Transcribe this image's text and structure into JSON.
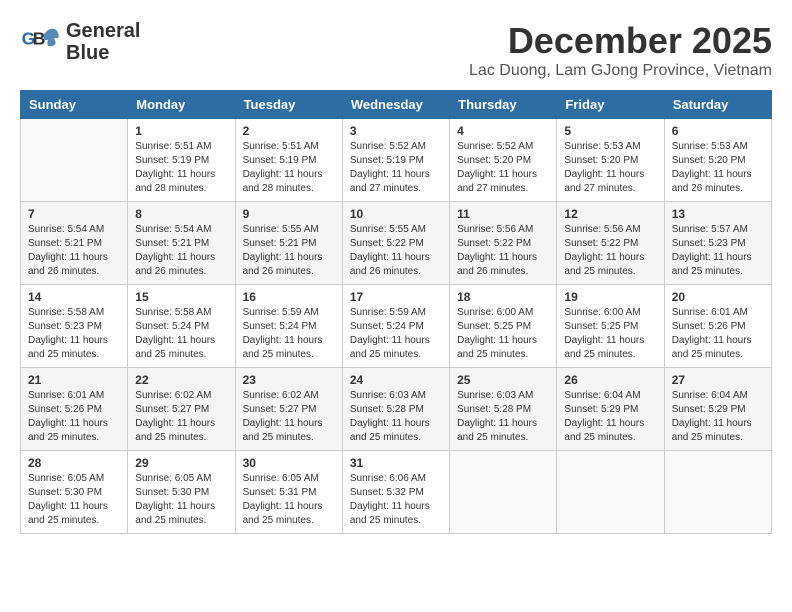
{
  "logo": {
    "line1": "General",
    "line2": "Blue"
  },
  "title": "December 2025",
  "subtitle": "Lac Duong, Lam GJong Province, Vietnam",
  "days_of_week": [
    "Sunday",
    "Monday",
    "Tuesday",
    "Wednesday",
    "Thursday",
    "Friday",
    "Saturday"
  ],
  "weeks": [
    [
      {
        "day": "",
        "info": ""
      },
      {
        "day": "1",
        "info": "Sunrise: 5:51 AM\nSunset: 5:19 PM\nDaylight: 11 hours\nand 28 minutes."
      },
      {
        "day": "2",
        "info": "Sunrise: 5:51 AM\nSunset: 5:19 PM\nDaylight: 11 hours\nand 28 minutes."
      },
      {
        "day": "3",
        "info": "Sunrise: 5:52 AM\nSunset: 5:19 PM\nDaylight: 11 hours\nand 27 minutes."
      },
      {
        "day": "4",
        "info": "Sunrise: 5:52 AM\nSunset: 5:20 PM\nDaylight: 11 hours\nand 27 minutes."
      },
      {
        "day": "5",
        "info": "Sunrise: 5:53 AM\nSunset: 5:20 PM\nDaylight: 11 hours\nand 27 minutes."
      },
      {
        "day": "6",
        "info": "Sunrise: 5:53 AM\nSunset: 5:20 PM\nDaylight: 11 hours\nand 26 minutes."
      }
    ],
    [
      {
        "day": "7",
        "info": "Sunrise: 5:54 AM\nSunset: 5:21 PM\nDaylight: 11 hours\nand 26 minutes."
      },
      {
        "day": "8",
        "info": "Sunrise: 5:54 AM\nSunset: 5:21 PM\nDaylight: 11 hours\nand 26 minutes."
      },
      {
        "day": "9",
        "info": "Sunrise: 5:55 AM\nSunset: 5:21 PM\nDaylight: 11 hours\nand 26 minutes."
      },
      {
        "day": "10",
        "info": "Sunrise: 5:55 AM\nSunset: 5:22 PM\nDaylight: 11 hours\nand 26 minutes."
      },
      {
        "day": "11",
        "info": "Sunrise: 5:56 AM\nSunset: 5:22 PM\nDaylight: 11 hours\nand 26 minutes."
      },
      {
        "day": "12",
        "info": "Sunrise: 5:56 AM\nSunset: 5:22 PM\nDaylight: 11 hours\nand 25 minutes."
      },
      {
        "day": "13",
        "info": "Sunrise: 5:57 AM\nSunset: 5:23 PM\nDaylight: 11 hours\nand 25 minutes."
      }
    ],
    [
      {
        "day": "14",
        "info": "Sunrise: 5:58 AM\nSunset: 5:23 PM\nDaylight: 11 hours\nand 25 minutes."
      },
      {
        "day": "15",
        "info": "Sunrise: 5:58 AM\nSunset: 5:24 PM\nDaylight: 11 hours\nand 25 minutes."
      },
      {
        "day": "16",
        "info": "Sunrise: 5:59 AM\nSunset: 5:24 PM\nDaylight: 11 hours\nand 25 minutes."
      },
      {
        "day": "17",
        "info": "Sunrise: 5:59 AM\nSunset: 5:24 PM\nDaylight: 11 hours\nand 25 minutes."
      },
      {
        "day": "18",
        "info": "Sunrise: 6:00 AM\nSunset: 5:25 PM\nDaylight: 11 hours\nand 25 minutes."
      },
      {
        "day": "19",
        "info": "Sunrise: 6:00 AM\nSunset: 5:25 PM\nDaylight: 11 hours\nand 25 minutes."
      },
      {
        "day": "20",
        "info": "Sunrise: 6:01 AM\nSunset: 5:26 PM\nDaylight: 11 hours\nand 25 minutes."
      }
    ],
    [
      {
        "day": "21",
        "info": "Sunrise: 6:01 AM\nSunset: 5:26 PM\nDaylight: 11 hours\nand 25 minutes."
      },
      {
        "day": "22",
        "info": "Sunrise: 6:02 AM\nSunset: 5:27 PM\nDaylight: 11 hours\nand 25 minutes."
      },
      {
        "day": "23",
        "info": "Sunrise: 6:02 AM\nSunset: 5:27 PM\nDaylight: 11 hours\nand 25 minutes."
      },
      {
        "day": "24",
        "info": "Sunrise: 6:03 AM\nSunset: 5:28 PM\nDaylight: 11 hours\nand 25 minutes."
      },
      {
        "day": "25",
        "info": "Sunrise: 6:03 AM\nSunset: 5:28 PM\nDaylight: 11 hours\nand 25 minutes."
      },
      {
        "day": "26",
        "info": "Sunrise: 6:04 AM\nSunset: 5:29 PM\nDaylight: 11 hours\nand 25 minutes."
      },
      {
        "day": "27",
        "info": "Sunrise: 6:04 AM\nSunset: 5:29 PM\nDaylight: 11 hours\nand 25 minutes."
      }
    ],
    [
      {
        "day": "28",
        "info": "Sunrise: 6:05 AM\nSunset: 5:30 PM\nDaylight: 11 hours\nand 25 minutes."
      },
      {
        "day": "29",
        "info": "Sunrise: 6:05 AM\nSunset: 5:30 PM\nDaylight: 11 hours\nand 25 minutes."
      },
      {
        "day": "30",
        "info": "Sunrise: 6:05 AM\nSunset: 5:31 PM\nDaylight: 11 hours\nand 25 minutes."
      },
      {
        "day": "31",
        "info": "Sunrise: 6:06 AM\nSunset: 5:32 PM\nDaylight: 11 hours\nand 25 minutes."
      },
      {
        "day": "",
        "info": ""
      },
      {
        "day": "",
        "info": ""
      },
      {
        "day": "",
        "info": ""
      }
    ]
  ]
}
